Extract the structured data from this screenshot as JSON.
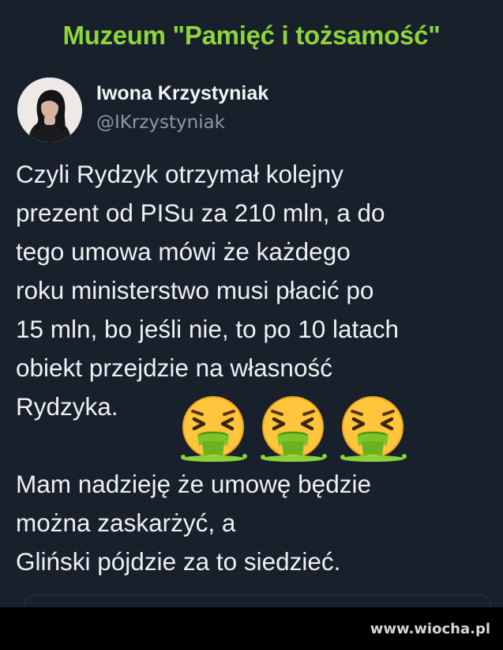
{
  "headline": "Muzeum \"Pamięć i tożsamość\"",
  "author": {
    "name": "Iwona Krzystyniak",
    "handle": "@IKrzystyniak"
  },
  "tweet": {
    "lines": [
      "Czyli Rydzyk otrzymał kolejny",
      "prezent od PISu za 210 mln, a do",
      "tego umowa mówi że każdego",
      "roku ministerstwo musi płacić po",
      "15 mln, bo jeśli nie, to po 10 latach",
      "obiekt przejdzie na własność",
      "Rydzyka.",
      "Mam nadzieję że umowę będzie",
      "można zaskarżyć, a",
      "Gliński pójdzie za to siedzieć."
    ],
    "emojis": [
      "face-vomiting-icon",
      "face-vomiting-icon",
      "face-vomiting-icon"
    ]
  },
  "watermark": "www.wiocha.pl",
  "colors": {
    "background": "#17202b",
    "headline": "#8fd43a",
    "text": "#eef1f3",
    "handle": "#8b98a5"
  }
}
